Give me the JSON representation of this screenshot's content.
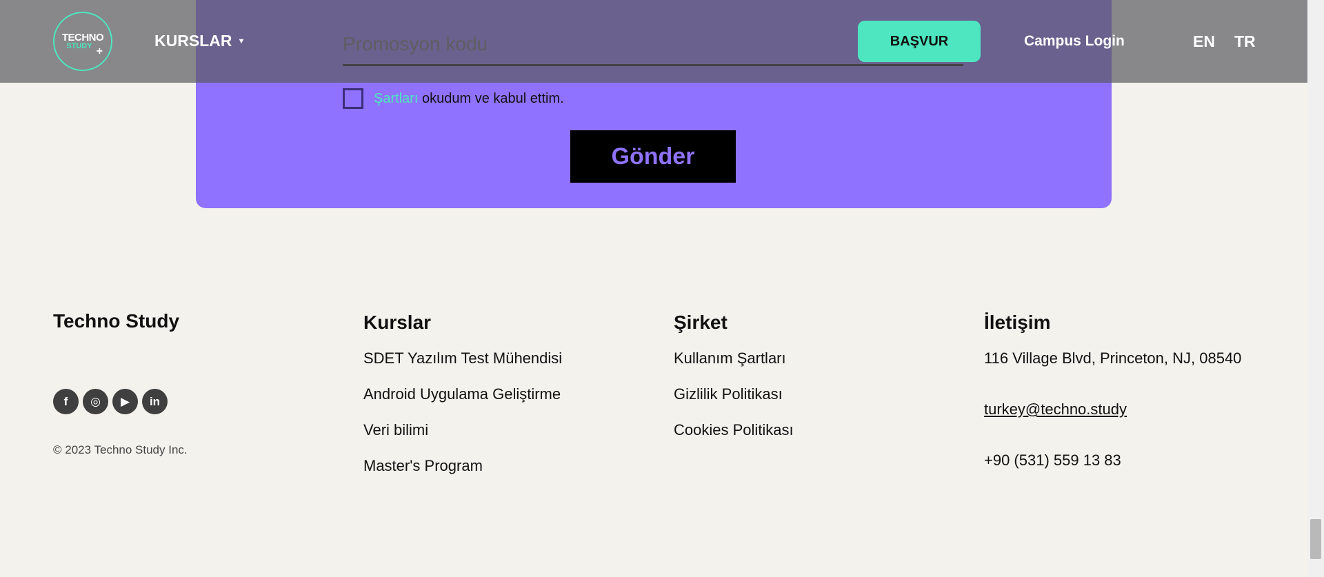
{
  "form": {
    "promo_placeholder": "Promosyon kodu",
    "terms_link": "Şartları",
    "terms_text": " okudum ve kabul ettim.",
    "submit_label": "Gönder"
  },
  "header": {
    "logo_line1": "TECHNO",
    "logo_line2": "STUDY",
    "logo_plus": "+",
    "courses_label": "KURSLAR",
    "apply_label": "BAŞVUR",
    "campus_login_label": "Campus Login",
    "lang_en": "EN",
    "lang_tr": "TR"
  },
  "footer": {
    "brand": "Techno Study",
    "copyright": "© 2023 Techno Study Inc.",
    "socials": [
      {
        "icon": "facebook-icon",
        "glyph": "f"
      },
      {
        "icon": "instagram-icon",
        "glyph": "◎"
      },
      {
        "icon": "youtube-icon",
        "glyph": "▶"
      },
      {
        "icon": "linkedin-icon",
        "glyph": "in"
      }
    ],
    "columns": {
      "kurslar": {
        "title": "Kurslar",
        "items": [
          "SDET Yazılım Test Mühendisi",
          "Android Uygulama Geliştirme",
          "Veri bilimi",
          "Master's Program"
        ]
      },
      "sirket": {
        "title": "Şirket",
        "items": [
          "Kullanım Şartları",
          "Gizlilik Politikası",
          "Cookies Politikası"
        ]
      },
      "iletisim": {
        "title": "İletişim",
        "address": "116 Village Blvd, Princeton, NJ, 08540",
        "email": "turkey@techno.study",
        "phone": "+90 (531) 559 13 83"
      }
    }
  },
  "colors": {
    "accent_teal": "#4ee6c0",
    "purple": "#8f72ff",
    "background": "#f4f2ec"
  }
}
